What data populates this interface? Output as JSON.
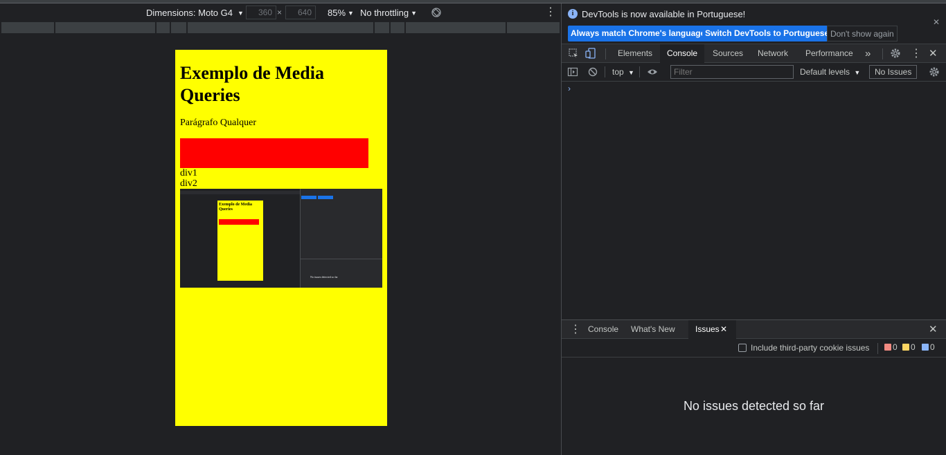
{
  "device_toolbar": {
    "dimensions_label": "Dimensions: Moto G4",
    "width_value": "360",
    "height_value": "640",
    "times": "×",
    "zoom": "85%",
    "throttling": "No throttling"
  },
  "page": {
    "heading": "Exemplo de Media Queries",
    "paragraph": "Parágrafo Qualquer",
    "div1": "div1",
    "div2": "div2",
    "mini_heading": "Exemplo de Media Queries",
    "mini_issues": "No issues detected so far",
    "bg_color": "#ffff00",
    "box_color": "#ff0000"
  },
  "infobar": {
    "message": "DevTools is now available in Portuguese!",
    "btn_match": "Always match Chrome's language",
    "btn_switch": "Switch DevTools to Portuguese",
    "btn_dismiss": "Don't show again"
  },
  "tabs": {
    "elements": "Elements",
    "console": "Console",
    "sources": "Sources",
    "network": "Network",
    "performance": "Performance",
    "more": "»"
  },
  "console_toolbar": {
    "context": "top",
    "filter_placeholder": "Filter",
    "levels": "Default levels",
    "issues": "No Issues"
  },
  "drawer": {
    "tab_console": "Console",
    "tab_whats_new": "What's New",
    "tab_issues": "Issues",
    "third_party_label": "Include third-party cookie issues",
    "error_count": "0",
    "warning_count": "0",
    "info_count": "0",
    "empty_message": "No issues detected so far"
  }
}
